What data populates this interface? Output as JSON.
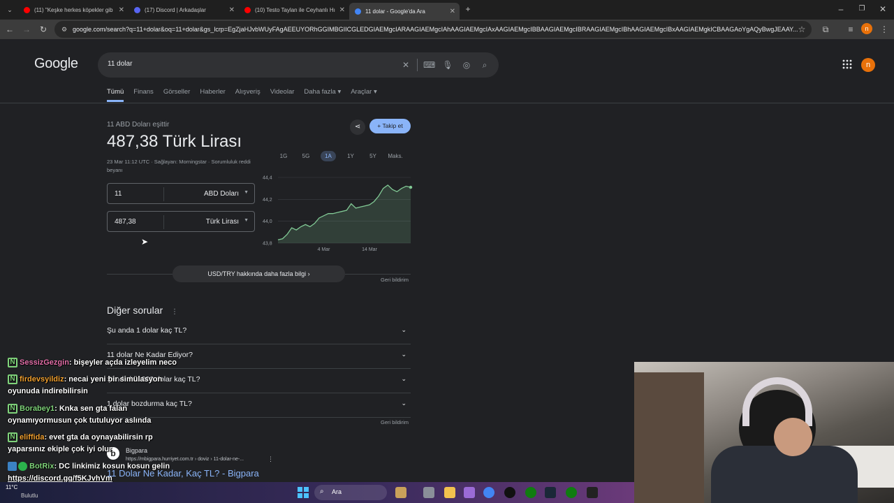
{
  "browser": {
    "tabs": [
      {
        "title": "(11) \"Keşke herkes köpekler gib",
        "icon": "youtube-icon",
        "color": "#ff0000"
      },
      {
        "title": "(17) Discord | Arkadaşlar",
        "icon": "discord-icon",
        "color": "#5865f2"
      },
      {
        "title": "(10) Testo Taylan ile Ceyhanlı Hı",
        "icon": "youtube-icon",
        "color": "#ff0000"
      },
      {
        "title": "11 dolar - Google'da Ara",
        "icon": "google-icon",
        "color": "#4285f4"
      }
    ],
    "url": "google.com/search?q=11+dolar&oq=11+dolar&gs_lcrp=EgZjaHJvbWUyFAgAEEUYORhGGIMBGIICGLEDGIAEMgcIARAAGIAEMgcIAhAAGIAEMgcIAxAAGIAEMgcIBBAAGIAEMgcIBRAAGIAEMgcIBhAAGIAEMgcIBxAAGIAEMgkICBAAGAoYgAQyBwgJEAAY...",
    "profile_initial": "n"
  },
  "google": {
    "logo": "Google",
    "query": "11 dolar",
    "tabs": [
      "Tümü",
      "Finans",
      "Görseller",
      "Haberler",
      "Alışveriş",
      "Videolar",
      "Daha fazla ▾",
      "Araçlar ▾"
    ],
    "avatar": "n"
  },
  "converter": {
    "equals_label": "11 ABD Doları eşittir",
    "result": "487,38 Türk Lirası",
    "meta": "23 Mar 11:12 UTC · Sağlayan: Morningstar · Sorumluluk reddi beyanı",
    "follow": "+ Takip et",
    "from_value": "11",
    "from_currency": "ABD Doları",
    "to_value": "487,38",
    "to_currency": "Türk Lirası",
    "ranges": [
      "1G",
      "5G",
      "1A",
      "1Y",
      "5Y",
      "Maks."
    ],
    "active_range": "1A",
    "more_info": "USD/TRY hakkında daha fazla bilgi  ›",
    "feedback": "Geri bildirim"
  },
  "chart_data": {
    "type": "line",
    "title": "",
    "xlabel": "",
    "ylabel": "",
    "ylim": [
      43.8,
      44.4
    ],
    "yticks": [
      "44,4",
      "44,2",
      "44,0",
      "43,8"
    ],
    "xticks": [
      "4 Mar",
      "14 Mar"
    ],
    "x": [
      "22 Feb",
      "23 Feb",
      "24 Feb",
      "25 Feb",
      "26 Feb",
      "27 Feb",
      "28 Feb",
      "1 Mar",
      "2 Mar",
      "3 Mar",
      "4 Mar",
      "5 Mar",
      "6 Mar",
      "7 Mar",
      "8 Mar",
      "9 Mar",
      "10 Mar",
      "11 Mar",
      "12 Mar",
      "13 Mar",
      "14 Mar",
      "15 Mar",
      "16 Mar",
      "17 Mar",
      "18 Mar",
      "19 Mar",
      "20 Mar",
      "21 Mar",
      "22 Mar",
      "23 Mar"
    ],
    "series": [
      {
        "values": [
          43.83,
          43.84,
          43.88,
          43.94,
          43.92,
          43.95,
          43.97,
          43.95,
          43.98,
          44.03,
          44.05,
          44.07,
          44.07,
          44.08,
          44.09,
          44.1,
          44.16,
          44.12,
          44.13,
          44.14,
          44.15,
          44.18,
          44.23,
          44.3,
          44.33,
          44.29,
          44.27,
          44.3,
          44.32,
          44.31
        ]
      }
    ],
    "grid": true,
    "color": "#81c995"
  },
  "paa": {
    "title": "Diğer sorular",
    "questions": [
      "Şu anda 1 dolar kaç TL?",
      "11 dolar Ne Kadar Ediyor?",
      "Şimdi de 1000 dolar kaç TL?",
      "1 dolar bozdurma kaç TL?"
    ],
    "feedback": "Geri bildirim"
  },
  "result": {
    "site": "Bigpara",
    "url": "https://mbigpara.hurriyet.com.tr › doviz › 11-dolar-ne-...",
    "title": "11 Dolar Ne Kadar, Kaç TL? - Bigpara"
  },
  "chat": [
    {
      "user": "SessizGezgin",
      "color": "#e36fa8",
      "text": ": bişeyler açda izleyelim neco"
    },
    {
      "user": "firdevsyildiz",
      "color": "#f0a030",
      "text": ": necai yeni bir simülasyon",
      "text2": "oyunuda indirebilirsin"
    },
    {
      "user": "Borabey1",
      "color": "#7fd37a",
      "text": ": Knka sen gta falan",
      "text2": "oynamıyormusun çok tutuluyor aslında"
    },
    {
      "user": "eliffida",
      "color": "#f0a030",
      "text": ": evet gta da oynayabilirsin rp",
      "text2": "yaparsınız ekiple çok iyi olur"
    },
    {
      "user": "BotRix",
      "color": "#7fd37a",
      "text": ": DC linkimiz kosun kosun gelin",
      "text2": "https://discord.gg/f5KJvhVm"
    }
  ],
  "taskbar": {
    "weather_temp": "11°C",
    "weather_label": "Bulutlu",
    "search": "Ara"
  }
}
